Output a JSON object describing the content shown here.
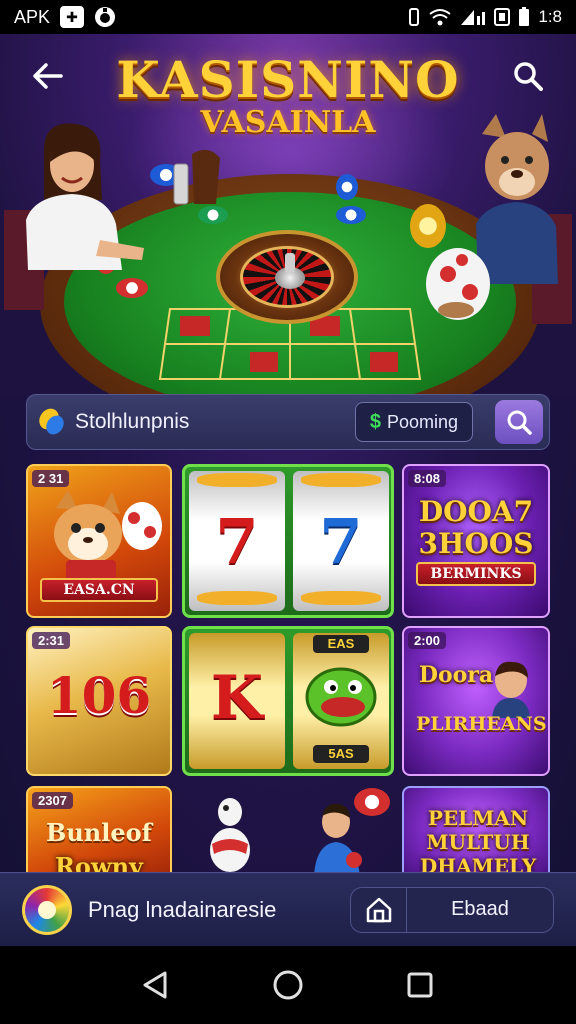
{
  "status_bar": {
    "app_label": "APK",
    "time": "1:8",
    "icons": [
      "game-controller-icon",
      "bell-icon",
      "vibrate-icon",
      "wifi-icon",
      "signal-icon",
      "data-icon",
      "battery-icon"
    ]
  },
  "header": {
    "back_icon": "arrow-left-icon",
    "search_icon": "search-icon",
    "logo_line1": "KASISNINO",
    "logo_line2": "VASAINLA"
  },
  "filter": {
    "label": "Stolhlunpnis",
    "chip_icon": "dollar-icon",
    "chip_label": "Pooming",
    "search_icon": "search-icon"
  },
  "tiles": [
    {
      "timer": "2 31",
      "title": "EASA.CN"
    },
    {
      "symbol": "7"
    },
    {
      "symbol": "7"
    },
    {
      "timer": "8:08",
      "title": "DOOA7 3HOOS",
      "banner": "BERMINKS"
    },
    {
      "timer": "2:31",
      "title": "106"
    },
    {
      "symbol": "K",
      "reel_text": "EAS",
      "reel_text2": "5AS"
    },
    {
      "timer": "2:00",
      "title": "Doora",
      "banner": "PLIRHEANS"
    },
    {
      "timer": "2307",
      "title": "Bunleof",
      "title2": "Rowny"
    },
    {
      "title": "PELMAN MULTUH DHAMELY"
    }
  ],
  "bottom_bar": {
    "logo_icon": "roulette-wheel-icon",
    "text": "Pnag lnadainaresie",
    "home_icon": "home-icon",
    "button_label": "Ebaad"
  },
  "nav_bar": {
    "back_icon": "nav-back-icon",
    "home_icon": "nav-home-icon",
    "recents_icon": "nav-recents-icon"
  },
  "colors": {
    "accent_gold": "#ffd23a",
    "felt_green": "#1f9a2a",
    "background_purple": "#22144a",
    "filter_bar": "#2f3260",
    "search_purple": "#7b5bd0"
  }
}
